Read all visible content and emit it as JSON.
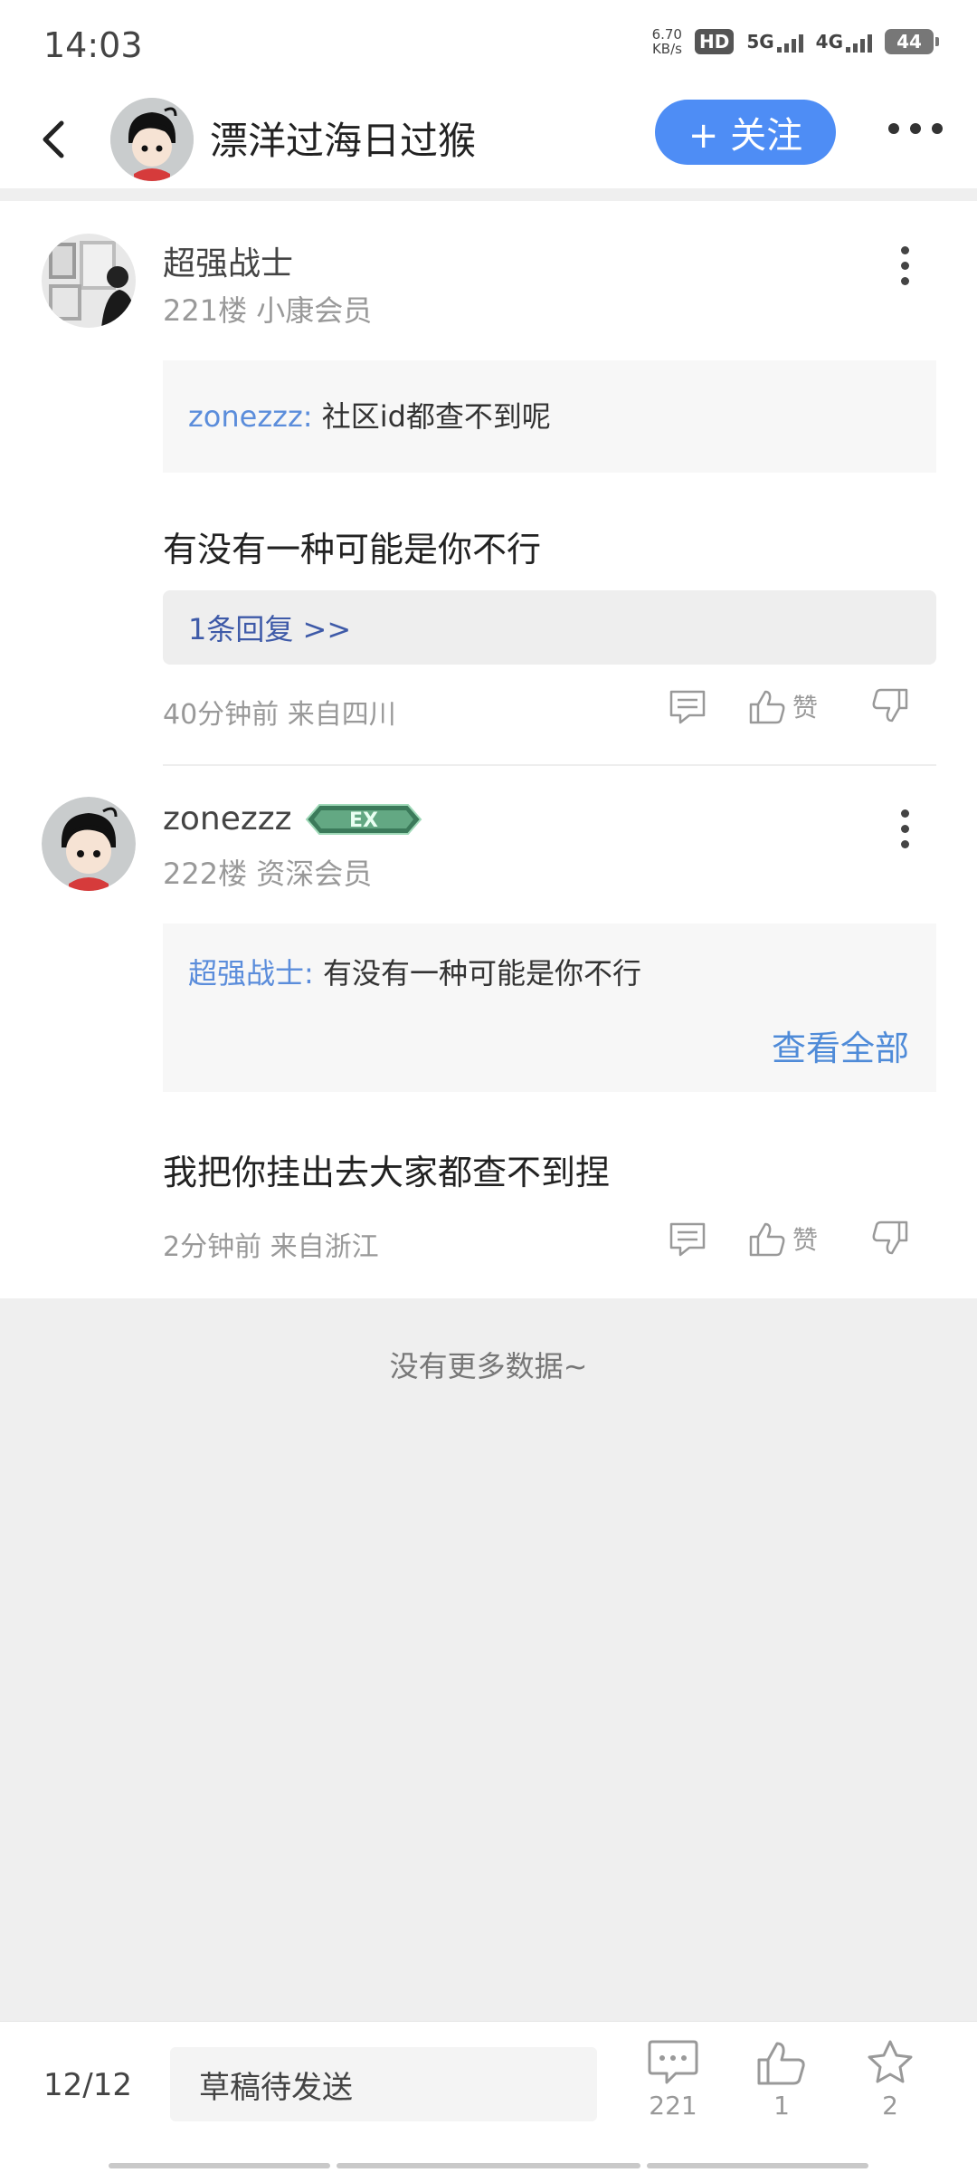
{
  "status_bar": {
    "time": "14:03",
    "speed_value": "6.70",
    "speed_unit": "KB/s",
    "hd": "HD",
    "net_5g": "5G",
    "net_4g": "4G",
    "battery": "44"
  },
  "header": {
    "title": "漂洋过海日过猴",
    "follow_label": "+ 关注"
  },
  "comments": [
    {
      "name": "超强战士",
      "floor": "221楼",
      "level": "小康会员",
      "quote_author": "zonezzz:",
      "quote_text": "社区id都查不到呢",
      "text": "有没有一种可能是你不行",
      "replies_label": "1条回复 >>",
      "time": "40分钟前",
      "location": "来自四川",
      "like_label": "赞"
    },
    {
      "name": "zonezzz",
      "badge": "EX",
      "floor": "222楼",
      "level": "资深会员",
      "quote_author": "超强战士:",
      "quote_text": "有没有一种可能是你不行",
      "view_all": "查看全部",
      "text": "我把你挂出去大家都查不到捏",
      "time": "2分钟前",
      "location": "来自浙江",
      "like_label": "赞"
    }
  ],
  "footer_text": "没有更多数据~",
  "bottom_bar": {
    "pager": "12/12",
    "draft_placeholder": "草稿待发送",
    "comment_count": "221",
    "like_count": "1",
    "star_count": "2"
  },
  "colors": {
    "accent": "#4e8df5",
    "link": "#5b8ddb",
    "replies": "#3e5aa8",
    "muted": "#999999"
  }
}
